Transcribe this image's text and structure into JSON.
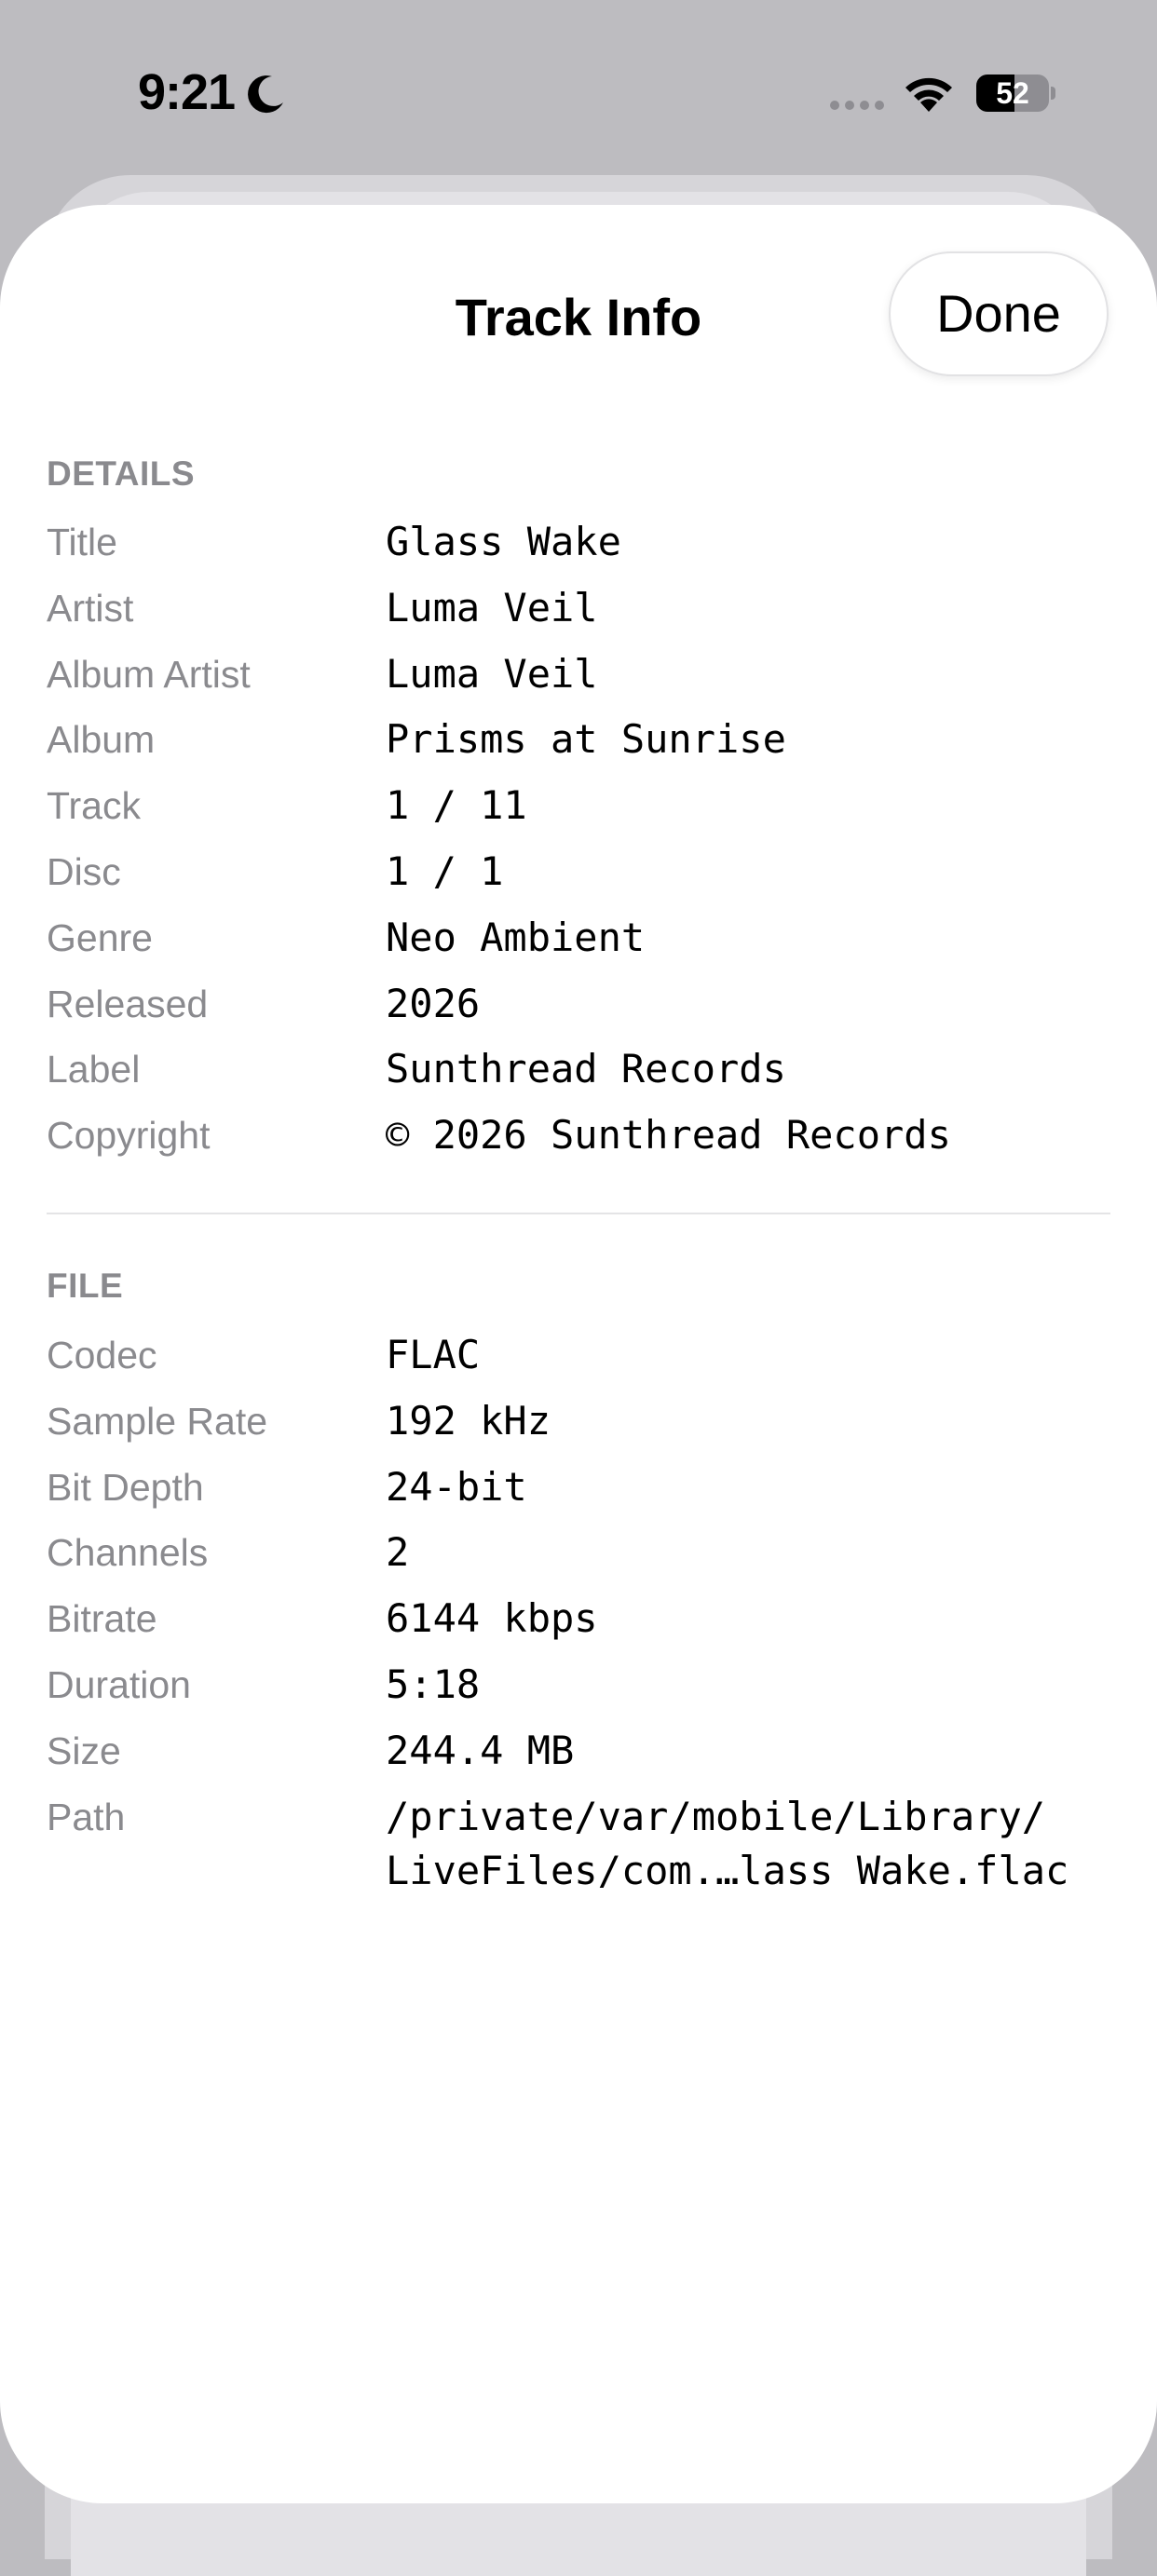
{
  "status_bar": {
    "time": "9:21",
    "battery": "52",
    "battery_level": 0.52
  },
  "sheet": {
    "title": "Track Info",
    "done_label": "Done"
  },
  "details": {
    "header": "DETAILS",
    "rows": [
      {
        "label": "Title",
        "value": "Glass Wake"
      },
      {
        "label": "Artist",
        "value": "Luma Veil"
      },
      {
        "label": "Album Artist",
        "value": "Luma Veil"
      },
      {
        "label": "Album",
        "value": "Prisms at Sunrise"
      },
      {
        "label": "Track",
        "value": "1 / 11"
      },
      {
        "label": "Disc",
        "value": "1 / 1"
      },
      {
        "label": "Genre",
        "value": "Neo Ambient"
      },
      {
        "label": "Released",
        "value": "2026"
      },
      {
        "label": "Label",
        "value": "Sunthread Records"
      },
      {
        "label": "Copyright",
        "value": "© 2026 Sunthread Records"
      }
    ]
  },
  "file": {
    "header": "FILE",
    "rows": [
      {
        "label": "Codec",
        "value": "FLAC"
      },
      {
        "label": "Sample Rate",
        "value": "192 kHz"
      },
      {
        "label": "Bit Depth",
        "value": "24-bit"
      },
      {
        "label": "Channels",
        "value": "2"
      },
      {
        "label": "Bitrate",
        "value": "6144 kbps"
      },
      {
        "label": "Duration",
        "value": "5:18"
      },
      {
        "label": "Size",
        "value": "244.4 MB"
      },
      {
        "label": "Path",
        "value_line1": "/private/var/mobile/Library/",
        "value_line2": "LiveFiles/com.…lass Wake.flac"
      }
    ]
  }
}
